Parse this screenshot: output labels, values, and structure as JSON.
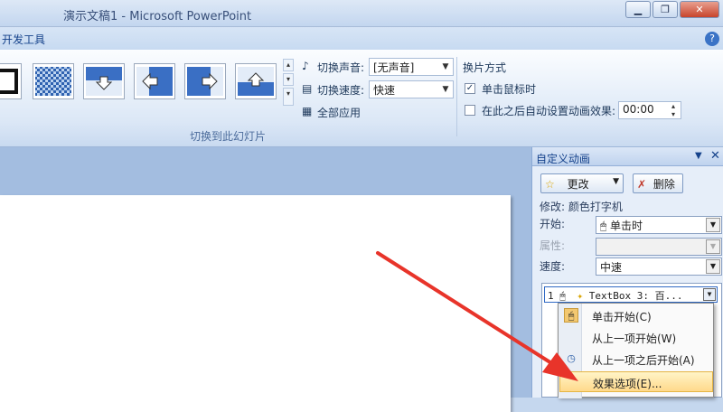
{
  "window": {
    "title": "演示文稿1 - Microsoft PowerPoint",
    "minimize": "▁",
    "restore": "❐",
    "close": "✕"
  },
  "tabs": {
    "developer": "开发工具",
    "help": "?"
  },
  "ribbon": {
    "sound_label": "切换声音:",
    "sound_value": "[无声音]",
    "speed_label": "切换速度:",
    "speed_value": "快速",
    "apply_all": "全部应用",
    "advance_header": "换片方式",
    "on_click": "单击鼠标时",
    "on_click_checked": true,
    "auto_after": "在此之后自动设置动画效果:",
    "auto_after_checked": false,
    "auto_time": "00:00",
    "group_label": "切换到此幻灯片"
  },
  "panel": {
    "title": "自定义动画",
    "change_button": "更改",
    "remove_button": "删除",
    "modify_label": "修改: 颜色打字机",
    "start_label": "开始:",
    "start_value": "单击时",
    "property_label": "属性:",
    "property_value": "",
    "speed_label": "速度:",
    "speed_value": "中速",
    "item": {
      "index": "1",
      "name": "TextBox 3: 百..."
    }
  },
  "context_menu": [
    {
      "label": "单击开始(C)",
      "icon": "mouse-click-icon",
      "highlight": false
    },
    {
      "label": "从上一项开始(W)",
      "icon": "",
      "highlight": false
    },
    {
      "label": "从上一项之后开始(A)",
      "icon": "clock-icon",
      "highlight": false
    },
    {
      "label": "效果选项(E)...",
      "icon": "",
      "highlight": true
    }
  ],
  "colors": {
    "accent": "#15428b",
    "annotation_arrow": "#e8342a",
    "highlight": "#ffd98b"
  }
}
